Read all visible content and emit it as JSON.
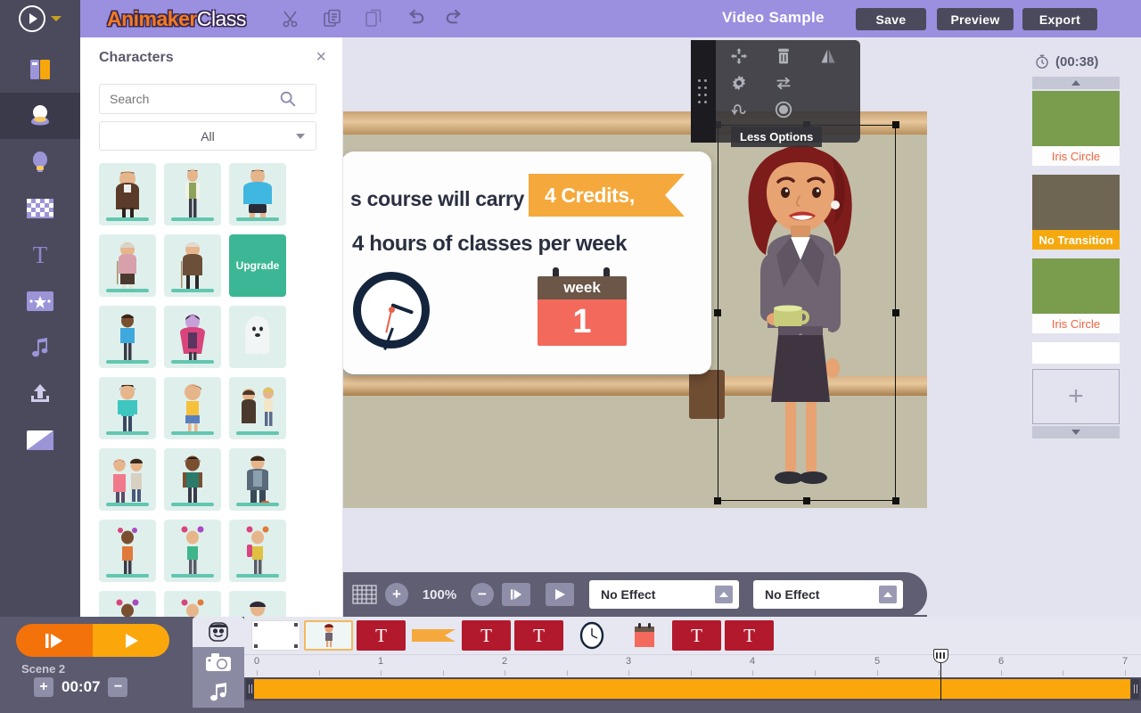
{
  "app": {
    "logo_primary": "Animaker",
    "logo_secondary": "Class",
    "video_title": "Video Sample"
  },
  "topbar": {
    "play_icon": "play-icon",
    "dropdown_icon": "chevron-down-icon",
    "tools": [
      {
        "name": "cut-icon",
        "label": "Cut"
      },
      {
        "name": "copy-icon",
        "label": "Copy"
      },
      {
        "name": "paste-icon",
        "label": "Paste"
      },
      {
        "name": "undo-icon",
        "label": "Undo"
      },
      {
        "name": "redo-icon",
        "label": "Redo"
      }
    ],
    "save_label": "Save",
    "preview_label": "Preview",
    "export_label": "Export"
  },
  "rail": {
    "items": [
      {
        "name": "library-icon",
        "label": "Library"
      },
      {
        "name": "character-icon",
        "label": "Characters",
        "active": true
      },
      {
        "name": "properties-icon",
        "label": "Properties"
      },
      {
        "name": "background-icon",
        "label": "Background"
      },
      {
        "name": "text-icon",
        "label": "Text"
      },
      {
        "name": "effects-icon",
        "label": "Effects"
      },
      {
        "name": "music-icon",
        "label": "Music"
      },
      {
        "name": "upload-icon",
        "label": "Upload"
      },
      {
        "name": "bg-color-icon",
        "label": "Color"
      }
    ]
  },
  "panel": {
    "title": "Characters",
    "close_label": "×",
    "search_placeholder": "Search",
    "search_value": "",
    "filter_value": "All",
    "filter_options": [
      "All"
    ],
    "upgrade_label": "Upgrade",
    "characters": [
      {
        "label": "Businessman Glasses"
      },
      {
        "label": "Tall Man Green"
      },
      {
        "label": "Large Man Hawaiian"
      },
      {
        "label": "Elderly Woman Cane"
      },
      {
        "label": "Elderly Man Cane"
      },
      {
        "label": "Upgrade",
        "upgrade": true
      },
      {
        "label": "Boy Blue Shirt"
      },
      {
        "label": "Vampire Girl"
      },
      {
        "label": "Ghost"
      },
      {
        "label": "Boy Teal Shirt"
      },
      {
        "label": "Girl Yellow Shirt"
      },
      {
        "label": "Two Men Talking"
      },
      {
        "label": "Couple"
      },
      {
        "label": "Woman Dark Skin"
      },
      {
        "label": "Worker Overalls"
      },
      {
        "label": "Boy Flowers"
      },
      {
        "label": "Kid Green Shirt"
      },
      {
        "label": "Kid Backpack"
      },
      {
        "label": "Girl Flowers"
      },
      {
        "label": "Girl Pink"
      },
      {
        "label": "Man Suit"
      }
    ]
  },
  "canvas": {
    "board_line1": "s course will carry",
    "ribbon_text": "4 Credits,",
    "board_line2": "4 hours of classes per week",
    "calendar_header": "week",
    "calendar_number": "1",
    "selected_object": "woman-presenter-character",
    "less_options_label": "Less Options",
    "context_tools": [
      {
        "name": "move-icon",
        "label": "Move"
      },
      {
        "name": "delete-icon",
        "label": "Delete"
      },
      {
        "name": "flip-icon",
        "label": "Flip"
      },
      {
        "name": "settings-icon",
        "label": "Settings"
      },
      {
        "name": "swap-icon",
        "label": "Swap"
      },
      {
        "name": "loop-icon",
        "label": "Loop"
      },
      {
        "name": "record-icon",
        "label": "Record"
      }
    ]
  },
  "controlbar": {
    "grid_icon": "grid-icon",
    "zoom_in_label": "+",
    "zoom_value": "100%",
    "zoom_out_label": "−",
    "step_icon": "step-forward-icon",
    "play_icon": "play-icon",
    "effect_in": "No Effect",
    "effect_out": "No Effect"
  },
  "scenes": {
    "timer_icon": "stopwatch-icon",
    "total_duration": "(00:38)",
    "scroll_up": "scroll-up",
    "scroll_down": "scroll-down",
    "add_label": "+",
    "items": [
      {
        "transition": "Iris Circle",
        "type": "transition"
      },
      {
        "transition": "No Transition",
        "type": "scene",
        "number": "2",
        "selected": true
      },
      {
        "transition": "Iris Circle",
        "type": "transition"
      }
    ]
  },
  "timeline": {
    "scene_label": "Scene 2",
    "scene_time": "00:07",
    "plus_label": "+",
    "minus_label": "−",
    "play_icon": "play-to-icon",
    "play2_icon": "play-icon",
    "tracks": [
      {
        "name": "character-track-icon",
        "label": "Characters"
      },
      {
        "name": "camera-track-icon",
        "label": "Camera"
      },
      {
        "name": "music-track-icon",
        "label": "Music"
      }
    ],
    "layers": [
      {
        "type": "white",
        "label": "Background"
      },
      {
        "type": "character",
        "label": "Character",
        "selected": true
      },
      {
        "type": "text",
        "label": "T"
      },
      {
        "type": "ribbon",
        "label": "Ribbon"
      },
      {
        "type": "text",
        "label": "T"
      },
      {
        "type": "text",
        "label": "T"
      },
      {
        "type": "clock",
        "label": "Clock"
      },
      {
        "type": "calendar",
        "label": "Calendar"
      },
      {
        "type": "text",
        "label": "T"
      },
      {
        "type": "text",
        "label": "T"
      }
    ],
    "ruler_ticks": [
      "0",
      "1",
      "2",
      "3",
      "4",
      "5",
      "6",
      "7"
    ],
    "playhead_time": 5.65,
    "ruler_max": 7
  },
  "colors": {
    "topbar": "#9b8fe0",
    "rail": "#4b4a5c",
    "accent_orange": "#f4720a",
    "accent_amber": "#fba70b",
    "panel_bg": "#e2e3ee",
    "transition_text": "#f4643f"
  }
}
